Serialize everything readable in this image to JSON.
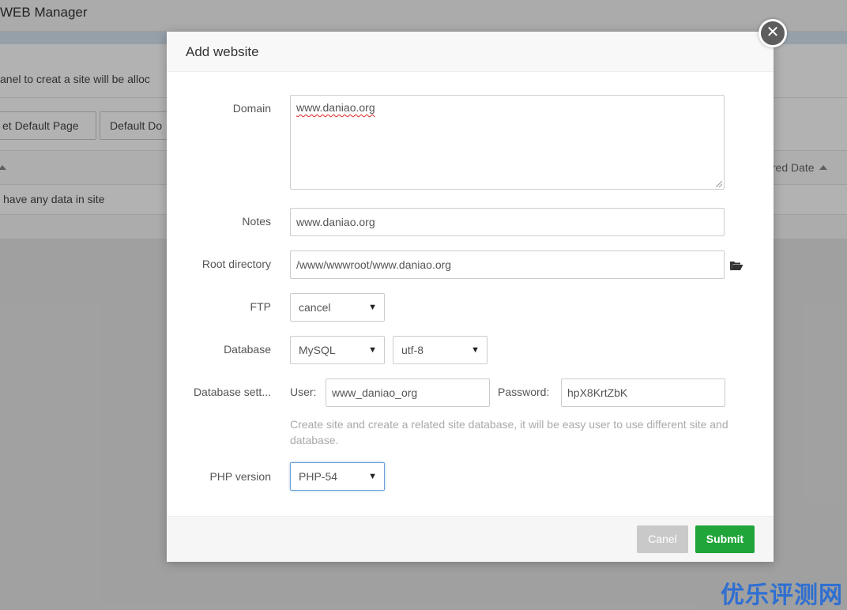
{
  "background": {
    "header_title": "WEB Manager",
    "notice_text": "anel to creat a site will be alloc",
    "buttons": [
      "et Default Page",
      "Default Do"
    ],
    "table": {
      "expire_column": "pired Date",
      "empty_text": " have any data in site"
    }
  },
  "modal": {
    "title": "Add website",
    "close_glyph": "✕",
    "fields": {
      "domain": {
        "label": "Domain",
        "value": "www.daniao.org"
      },
      "notes": {
        "label": "Notes",
        "value": "www.daniao.org"
      },
      "root_directory": {
        "label": "Root directory",
        "value": "/www/wwwroot/www.daniao.org",
        "icon": "folder-open-icon"
      },
      "ftp": {
        "label": "FTP",
        "selected": "cancel"
      },
      "database": {
        "label": "Database",
        "type_selected": "MySQL",
        "charset_selected": "utf-8"
      },
      "database_settings": {
        "label": "Database sett...",
        "user_label": "User:",
        "user_value": "www_daniao_org",
        "password_label": "Password:",
        "password_value": "hpX8KrtZbK",
        "help": "Create site and create a related site database, it will be easy user to use different site and database."
      },
      "php_version": {
        "label": "PHP version",
        "selected": "PHP-54"
      }
    },
    "buttons": {
      "cancel": "Canel",
      "submit": "Submit"
    }
  },
  "watermark": "优乐评测网",
  "colors": {
    "submit": "#20a53a",
    "cancel": "#c9c9c9",
    "watermark": "#2f6fd1"
  }
}
